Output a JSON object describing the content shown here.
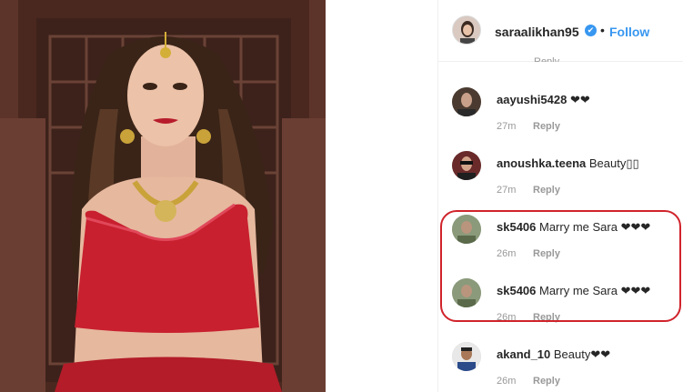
{
  "post": {
    "username": "saraalikhan95",
    "verified_mark": "✔",
    "separator": "•",
    "follow_label": "Follow",
    "partial_reply_label": "Reply"
  },
  "comments": [
    {
      "username": "aayushi5428",
      "text": " ❤❤",
      "time": "27m",
      "reply_label": "Reply"
    },
    {
      "username": "anoushka.teena",
      "text": " Beauty▯▯",
      "time": "27m",
      "reply_label": "Reply"
    },
    {
      "username": "sk5406",
      "text": " Marry me Sara ❤❤❤",
      "time": "26m",
      "reply_label": "Reply"
    },
    {
      "username": "sk5406",
      "text": " Marry me Sara ❤❤❤",
      "time": "26m",
      "reply_label": "Reply"
    },
    {
      "username": "akand_10",
      "text": " Beauty❤❤",
      "time": "26m",
      "reply_label": "Reply"
    }
  ],
  "colors": {
    "accent": "#3897f0",
    "highlight": "#d0232b",
    "dress": "#c8202e",
    "text": "#262626",
    "muted": "#999999"
  }
}
